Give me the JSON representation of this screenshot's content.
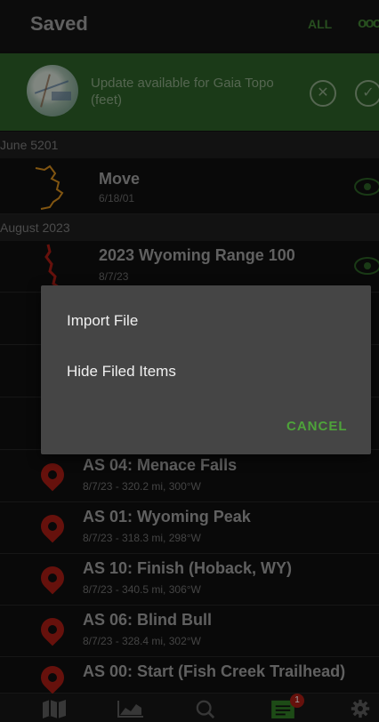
{
  "header": {
    "title": "Saved",
    "filter_all": "ALL",
    "more": "ooo"
  },
  "banner": {
    "message": "Update available for Gaia Topo (feet)",
    "dismiss_icon": "close-circle-icon",
    "accept_icon": "check-circle-icon"
  },
  "sections": [
    {
      "label": "June 5201"
    },
    {
      "label": "August 2023"
    }
  ],
  "tracks": [
    {
      "title": "Move",
      "subtitle": "6/18/01"
    },
    {
      "title": "2023 Wyoming Range 100",
      "subtitle": "8/7/23"
    }
  ],
  "waypoints": [
    {
      "title": "AS 04: Menace Falls",
      "subtitle": "8/7/23 - 320.2 mi, 300°W"
    },
    {
      "title": "AS 01: Wyoming Peak",
      "subtitle": "8/7/23 - 318.3 mi, 298°W"
    },
    {
      "title": "AS 10: Finish (Hoback, WY)",
      "subtitle": "8/7/23 - 340.5 mi, 306°W"
    },
    {
      "title": "AS 06: Blind Bull",
      "subtitle": "8/7/23 - 328.4 mi, 302°W"
    },
    {
      "title": "AS 00: Start (Fish Creek Trailhead)",
      "subtitle": ""
    }
  ],
  "dialog": {
    "option_import": "Import File",
    "option_hide": "Hide Filed Items",
    "cancel": "CANCEL"
  },
  "bottom_nav": {
    "items": [
      "map-icon",
      "chart-icon",
      "search-icon",
      "saved-list-icon",
      "settings-icon"
    ],
    "badge": "1"
  },
  "colors": {
    "accent": "#4ea33a",
    "banner": "#2c5e27",
    "pin": "#a51c14",
    "track": "#d08a1c"
  }
}
